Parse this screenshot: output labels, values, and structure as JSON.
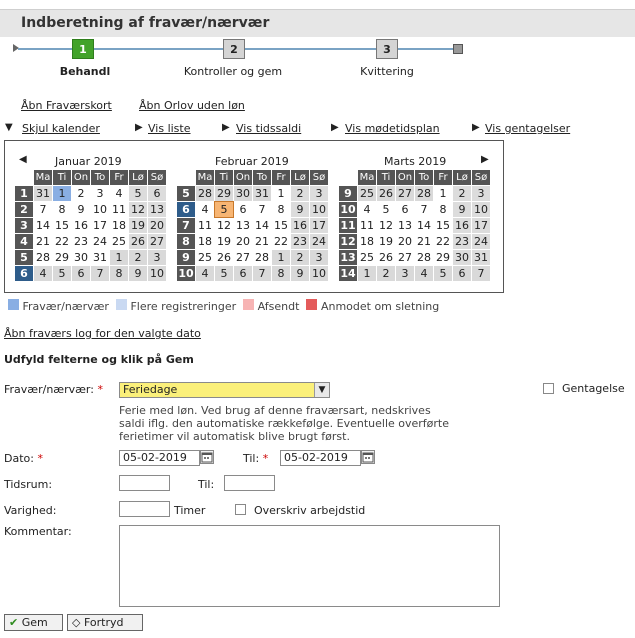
{
  "header": {
    "title": "Indberetning af fravær/nærvær"
  },
  "wizard": {
    "steps": [
      {
        "num": "1",
        "label": "Behandl",
        "active": true
      },
      {
        "num": "2",
        "label": "Kontroller og gem",
        "active": false
      },
      {
        "num": "3",
        "label": "Kvittering",
        "active": false
      }
    ]
  },
  "links": {
    "open_absence_card": "Åbn Fraværskort",
    "open_leave": "Åbn Orlov uden løn",
    "hide_calendar": "Skjul kalender",
    "show_list": "Vis liste",
    "show_balance": "Vis tidssaldi",
    "show_meeting_plan": "Vis mødetidsplan",
    "show_repeats": "Vis gentagelser",
    "open_log": "Åbn fraværs log for den valgte dato"
  },
  "calendar": {
    "day_headers": [
      "Ma",
      "Ti",
      "On",
      "To",
      "Fr",
      "Lø",
      "Sø"
    ],
    "months": [
      {
        "title": "Januar 2019",
        "weeks": [
          {
            "wk": "1",
            "days": [
              "31",
              "1",
              "2",
              "3",
              "4",
              "5",
              "6"
            ]
          },
          {
            "wk": "2",
            "days": [
              "7",
              "8",
              "9",
              "10",
              "11",
              "12",
              "13"
            ]
          },
          {
            "wk": "3",
            "days": [
              "14",
              "15",
              "16",
              "17",
              "18",
              "19",
              "20"
            ]
          },
          {
            "wk": "4",
            "days": [
              "21",
              "22",
              "23",
              "24",
              "25",
              "26",
              "27"
            ]
          },
          {
            "wk": "5",
            "days": [
              "28",
              "29",
              "30",
              "31",
              "1",
              "2",
              "3"
            ]
          },
          {
            "wk": "6",
            "days": [
              "4",
              "5",
              "6",
              "7",
              "8",
              "9",
              "10"
            ]
          }
        ]
      },
      {
        "title": "Februar 2019",
        "weeks": [
          {
            "wk": "5",
            "days": [
              "28",
              "29",
              "30",
              "31",
              "1",
              "2",
              "3"
            ]
          },
          {
            "wk": "6",
            "days": [
              "4",
              "5",
              "6",
              "7",
              "8",
              "9",
              "10"
            ]
          },
          {
            "wk": "7",
            "days": [
              "11",
              "12",
              "13",
              "14",
              "15",
              "16",
              "17"
            ]
          },
          {
            "wk": "8",
            "days": [
              "18",
              "19",
              "20",
              "21",
              "22",
              "23",
              "24"
            ]
          },
          {
            "wk": "9",
            "days": [
              "25",
              "26",
              "27",
              "28",
              "1",
              "2",
              "3"
            ]
          },
          {
            "wk": "10",
            "days": [
              "4",
              "5",
              "6",
              "7",
              "8",
              "9",
              "10"
            ]
          }
        ]
      },
      {
        "title": "Marts 2019",
        "weeks": [
          {
            "wk": "9",
            "days": [
              "25",
              "26",
              "27",
              "28",
              "1",
              "2",
              "3"
            ]
          },
          {
            "wk": "10",
            "days": [
              "4",
              "5",
              "6",
              "7",
              "8",
              "9",
              "10"
            ]
          },
          {
            "wk": "11",
            "days": [
              "11",
              "12",
              "13",
              "14",
              "15",
              "16",
              "17"
            ]
          },
          {
            "wk": "12",
            "days": [
              "18",
              "19",
              "20",
              "21",
              "22",
              "23",
              "24"
            ]
          },
          {
            "wk": "13",
            "days": [
              "25",
              "26",
              "27",
              "28",
              "29",
              "30",
              "31"
            ]
          },
          {
            "wk": "14",
            "days": [
              "1",
              "2",
              "3",
              "4",
              "5",
              "6",
              "7"
            ]
          }
        ]
      }
    ]
  },
  "legend": [
    {
      "label": "Fravær/nærvær",
      "color": "#89aee3"
    },
    {
      "label": "Flere registreringer",
      "color": "#c9d9f2"
    },
    {
      "label": "Afsendt",
      "color": "#f7b4b4"
    },
    {
      "label": "Anmodet om sletning",
      "color": "#e45b5b"
    }
  ],
  "form": {
    "instruction": "Udfyld felterne og klik på Gem",
    "absence_label": "Fravær/nærvær:",
    "absence_value": "Feriedage",
    "repeat_label": "Gentagelse",
    "description": "Ferie med løn. Ved brug af denne fraværsart, nedskrives saldi iflg. den automatiske rækkefølge. Eventuelle overførte ferietimer vil automatisk blive brugt først.",
    "date_label": "Dato:",
    "date_value": "05-02-2019",
    "to_label": "Til:",
    "to_value": "05-02-2019",
    "period_label": "Tidsrum:",
    "period_to_label": "Til:",
    "duration_label": "Varighed:",
    "hours_label": "Timer",
    "overwrite_label": "Overskriv arbejdstid",
    "comment_label": "Kommentar:"
  },
  "buttons": {
    "save": "Gem",
    "cancel": "Fortryd"
  }
}
